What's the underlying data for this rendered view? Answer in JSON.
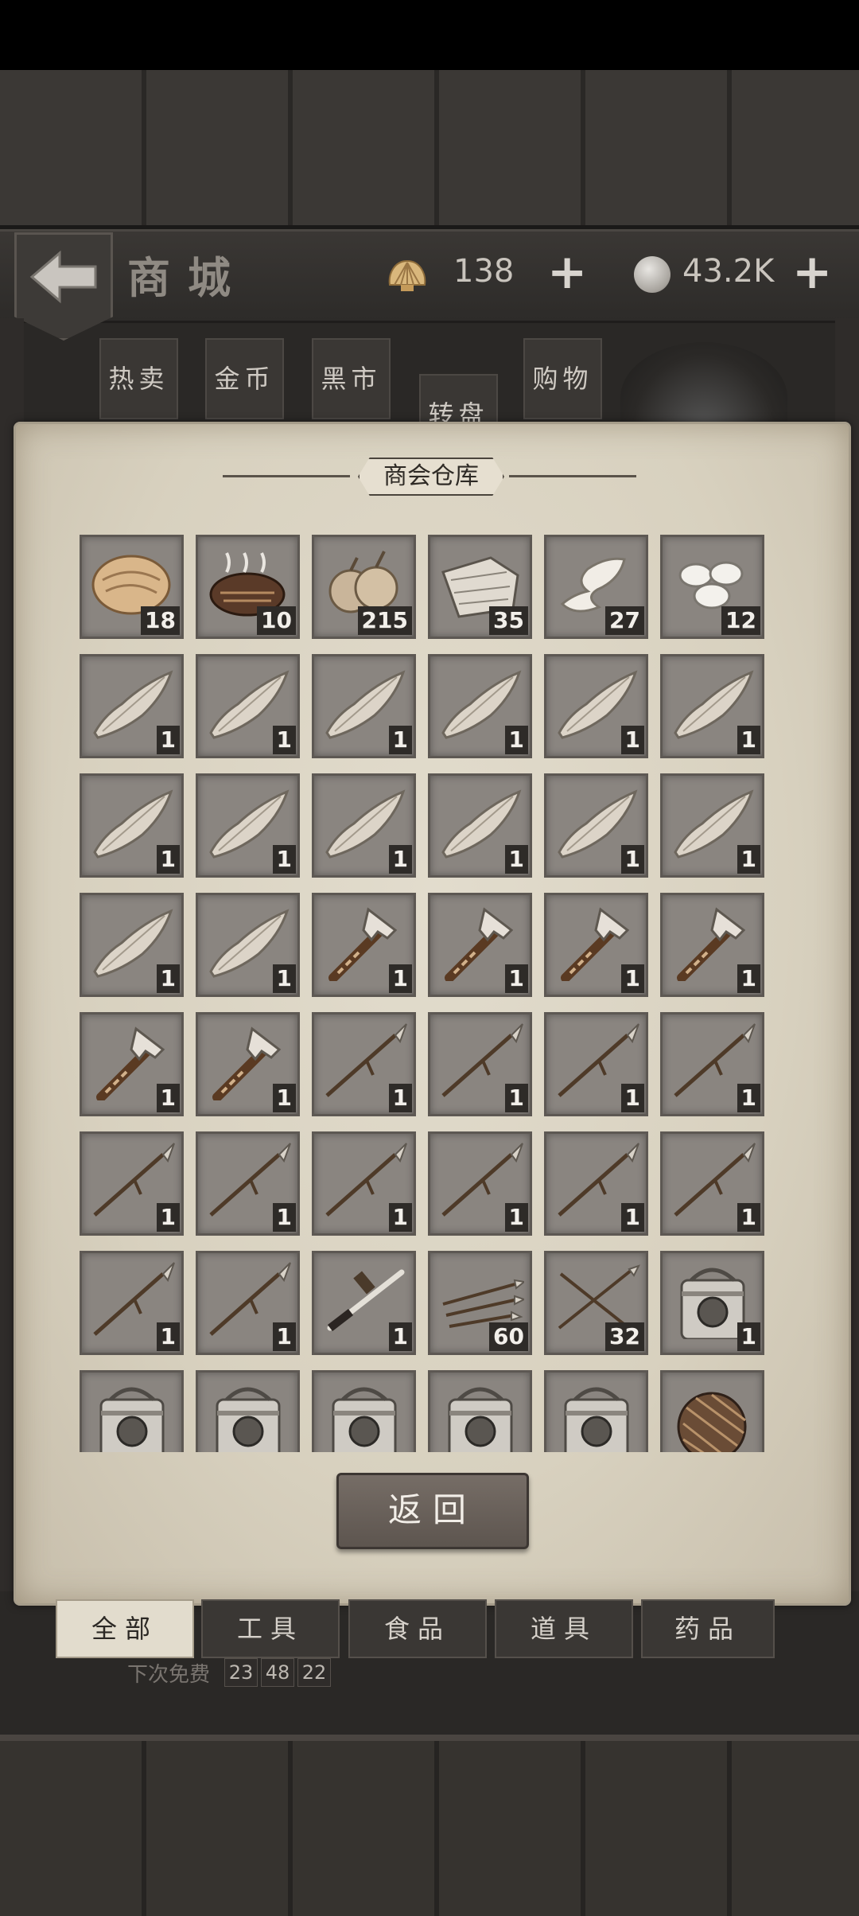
{
  "header": {
    "title": "商城",
    "currency1": {
      "icon": "shell-icon",
      "value": "138"
    },
    "currency2": {
      "icon": "silver-coin-icon",
      "value": "43.2K"
    }
  },
  "top_tabs": [
    "热卖",
    "金币",
    "黑市",
    "转盘",
    "购物"
  ],
  "panel": {
    "title": "商会仓库",
    "return_label": "返回"
  },
  "inventory": [
    {
      "item": "bread",
      "qty": "18"
    },
    {
      "item": "roasted-meat",
      "qty": "10"
    },
    {
      "item": "onion",
      "qty": "215"
    },
    {
      "item": "hide",
      "qty": "35"
    },
    {
      "item": "bone-shard",
      "qty": "27"
    },
    {
      "item": "pebbles",
      "qty": "12"
    },
    {
      "item": "stone-blade",
      "qty": "1"
    },
    {
      "item": "stone-blade",
      "qty": "1"
    },
    {
      "item": "stone-blade",
      "qty": "1"
    },
    {
      "item": "stone-blade",
      "qty": "1"
    },
    {
      "item": "stone-blade",
      "qty": "1"
    },
    {
      "item": "stone-blade",
      "qty": "1"
    },
    {
      "item": "stone-blade",
      "qty": "1"
    },
    {
      "item": "stone-blade",
      "qty": "1"
    },
    {
      "item": "stone-blade",
      "qty": "1"
    },
    {
      "item": "stone-blade",
      "qty": "1"
    },
    {
      "item": "stone-blade",
      "qty": "1"
    },
    {
      "item": "stone-blade",
      "qty": "1"
    },
    {
      "item": "stone-blade",
      "qty": "1"
    },
    {
      "item": "stone-blade",
      "qty": "1"
    },
    {
      "item": "axe",
      "qty": "1"
    },
    {
      "item": "axe",
      "qty": "1"
    },
    {
      "item": "axe",
      "qty": "1"
    },
    {
      "item": "axe",
      "qty": "1"
    },
    {
      "item": "axe",
      "qty": "1"
    },
    {
      "item": "axe",
      "qty": "1"
    },
    {
      "item": "spear",
      "qty": "1"
    },
    {
      "item": "spear",
      "qty": "1"
    },
    {
      "item": "spear",
      "qty": "1"
    },
    {
      "item": "spear",
      "qty": "1"
    },
    {
      "item": "spear",
      "qty": "1"
    },
    {
      "item": "spear",
      "qty": "1"
    },
    {
      "item": "spear",
      "qty": "1"
    },
    {
      "item": "spear",
      "qty": "1"
    },
    {
      "item": "spear",
      "qty": "1"
    },
    {
      "item": "spear",
      "qty": "1"
    },
    {
      "item": "spear",
      "qty": "1"
    },
    {
      "item": "spear",
      "qty": "1"
    },
    {
      "item": "sword",
      "qty": "1"
    },
    {
      "item": "arrows",
      "qty": "60"
    },
    {
      "item": "crossed-arrows",
      "qty": "32"
    },
    {
      "item": "iron-box",
      "qty": "1"
    },
    {
      "item": "iron-box",
      "qty": ""
    },
    {
      "item": "iron-box",
      "qty": ""
    },
    {
      "item": "iron-box",
      "qty": ""
    },
    {
      "item": "iron-box",
      "qty": ""
    },
    {
      "item": "iron-box",
      "qty": ""
    },
    {
      "item": "woven-ball",
      "qty": ""
    }
  ],
  "bottom_tabs": [
    "全部",
    "工具",
    "食品",
    "道具",
    "药品"
  ],
  "timer": {
    "label": "下次免费",
    "h": "23",
    "m": "48",
    "s": "22"
  }
}
